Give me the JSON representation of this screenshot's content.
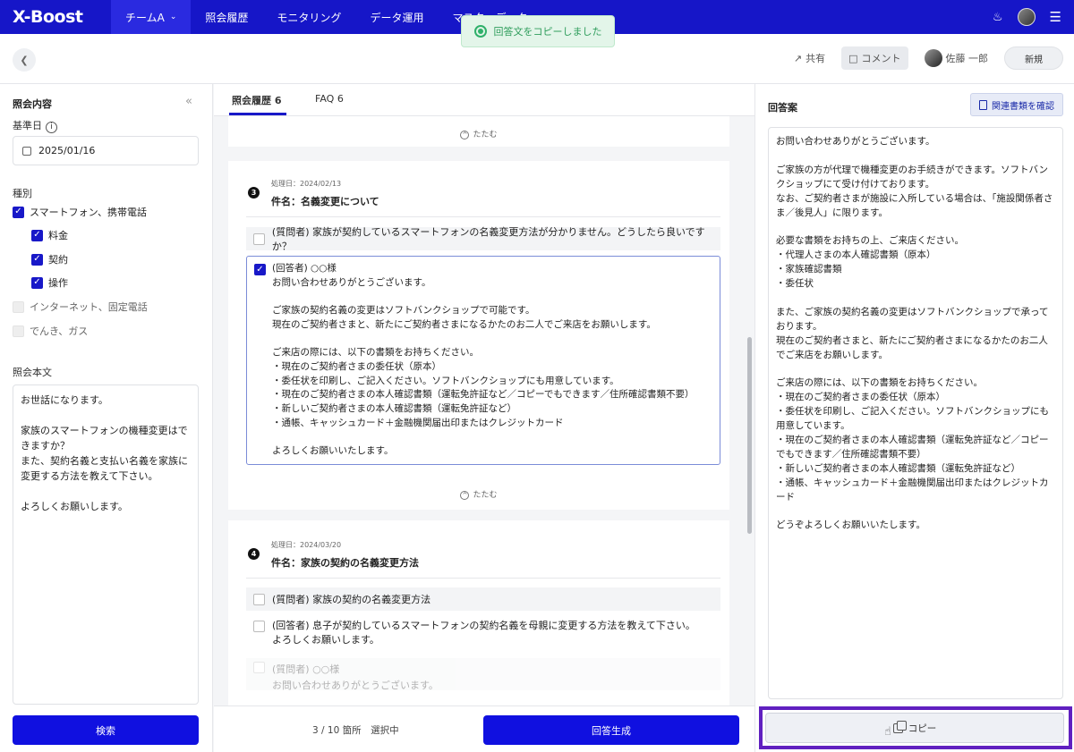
{
  "app": {
    "logo": "X-Boost"
  },
  "nav": {
    "items": [
      "チームA",
      "照会履歴",
      "モニタリング",
      "データ運用",
      "マスターデータ"
    ]
  },
  "toast": {
    "text": "回答文をコピーしました"
  },
  "subheader": {
    "share": "共有",
    "comment": "コメント",
    "user": "佐藤 一郎",
    "new": "新規"
  },
  "left": {
    "title": "照会内容",
    "date_label": "基準日",
    "date_value": "2025/01/16",
    "category_label": "種別",
    "categories": [
      {
        "label": "スマートフォン、携帯電話",
        "checked": true
      },
      {
        "label": "料金",
        "checked": true
      },
      {
        "label": "契約",
        "checked": true
      },
      {
        "label": "操作",
        "checked": true
      },
      {
        "label": "インターネット、固定電話",
        "checked": false
      },
      {
        "label": "でんき、ガス",
        "checked": false
      }
    ],
    "body_label": "照会本文",
    "body_text": "お世話になります。\n\n家族のスマートフォンの機種変更はできますか？\nまた、契約名義と支払い名義を家族に変更する方法を教えて下さい。\n\nよろしくお願いします。",
    "search_button": "検索"
  },
  "middle": {
    "tabs": [
      {
        "label": "照会履歴",
        "count": "6"
      },
      {
        "label": "FAQ",
        "count": "6"
      }
    ],
    "fold_label": "たたむ",
    "cards": [
      {
        "number": "3",
        "date": "処理日：2024/02/13",
        "subject": "件名：名義変更について",
        "question": "(質問者) 家族が契約しているスマートフォンの名義変更方法が分かりません。どうしたら良いですか？",
        "answer": "(回答者) ○○様\nお問い合わせありがとうございます。\n\nご家族の契約名義の変更はソフトバンクショップで可能です。\n現在のご契約者さまと、新たにご契約者さまになるかたのお二人でご来店をお願いします。\n\nご来店の際には、以下の書類をお持ちください。\n・現在のご契約者さまの委任状（原本）\n・委任状を印刷し、ご記入ください。ソフトバンクショップにも用意しています。\n・現在のご契約者さまの本人確認書類（運転免許証など／コピーでもできます／住所確認書類不要）\n・新しいご契約者さまの本人確認書類（運転免許証など）\n・通帳、キャッシュカード＋金融機関届出印またはクレジットカード\n\nよろしくお願いいたします。"
      },
      {
        "number": "4",
        "date": "処理日：2024/03/20",
        "subject": "件名：家族の契約の名義変更方法",
        "question": "(質問者) 家族の契約の名義変更方法",
        "answer": "(回答者) 息子が契約しているスマートフォンの契約名義を母親に変更する方法を教えて下さい。\nよろしくお願いします。",
        "question2": "(質問者) ○○様",
        "question2_sub": "お問い合わせありがとうございます。"
      }
    ],
    "selection": "3 / 10 箇所　選択中",
    "generate_button": "回答生成"
  },
  "right": {
    "title": "回答案",
    "docs_button": "関連書類を確認",
    "answer": "お問い合わせありがとうございます。\n\nご家族の方が代理で機種変更のお手続きができます。ソフトバンクショップにて受け付けております。\nなお、ご契約者さまが施設に入所している場合は、「施設関係者さま／後見人」に限ります。\n\n必要な書類をお持ちの上、ご来店ください。\n・代理人さまの本人確認書類（原本）\n・家族確認書類\n・委任状\n\nまた、ご家族の契約名義の変更はソフトバンクショップで承っております。\n現在のご契約者さまと、新たにご契約者さまになるかたのお二人でご来店をお願いします。\n\nご来店の際には、以下の書類をお持ちください。\n・現在のご契約者さまの委任状（原本）\n・委任状を印刷し、ご記入ください。ソフトバンクショップにも用意しています。\n・現在のご契約者さまの本人確認書類（運転免許証など／コピーでもできます／住所確認書類不要）\n・新しいご契約者さまの本人確認書類（運転免許証など）\n・通帳、キャッシュカード＋金融機関届出印またはクレジットカード\n\nどうぞよろしくお願いいたします。",
    "copy_button": "コピー"
  }
}
